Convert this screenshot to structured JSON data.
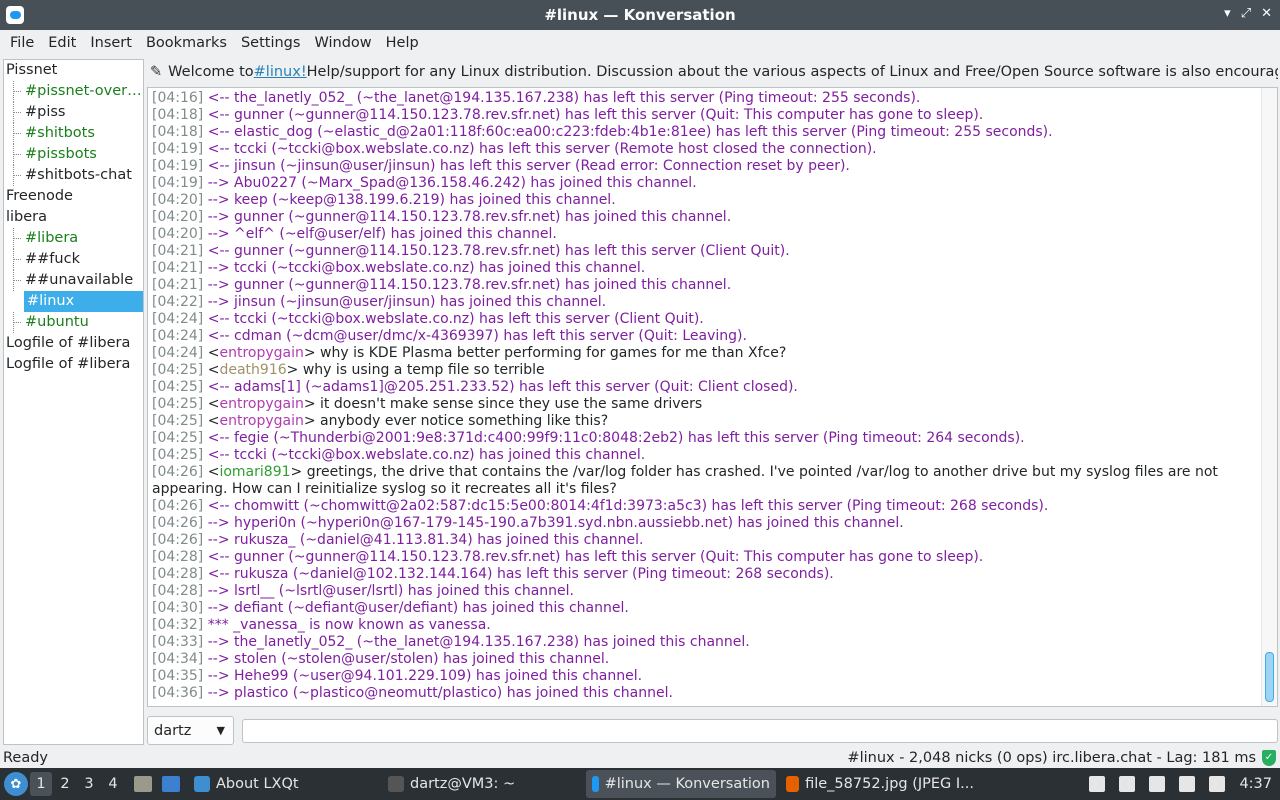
{
  "window": {
    "title": "#linux — Konversation",
    "controls": [
      "▾",
      "⤢",
      "✕"
    ]
  },
  "menu": [
    "File",
    "Edit",
    "Insert",
    "Bookmarks",
    "Settings",
    "Window",
    "Help"
  ],
  "sidebar": [
    {
      "label": "Pissnet",
      "child": false,
      "green": false
    },
    {
      "label": "#pissnet-overview",
      "child": true,
      "green": true
    },
    {
      "label": "#piss",
      "child": true,
      "green": false
    },
    {
      "label": "#shitbots",
      "child": true,
      "green": true
    },
    {
      "label": "#pissbots",
      "child": true,
      "green": true
    },
    {
      "label": "#shitbots-chat",
      "child": true,
      "green": false
    },
    {
      "label": "Freenode",
      "child": false,
      "green": false
    },
    {
      "label": "libera",
      "child": false,
      "green": false
    },
    {
      "label": "#libera",
      "child": true,
      "green": true
    },
    {
      "label": "##fuck",
      "child": true,
      "green": false
    },
    {
      "label": "##unavailable",
      "child": true,
      "green": false
    },
    {
      "label": "#linux",
      "child": true,
      "green": false,
      "selected": true
    },
    {
      "label": "#ubuntu",
      "child": true,
      "green": true
    },
    {
      "label": "Logfile of #libera",
      "child": false,
      "green": false
    },
    {
      "label": "Logfile of #libera",
      "child": false,
      "green": false
    }
  ],
  "topic": {
    "prefix": "Welcome to ",
    "link": "#linux!",
    "suffix": " Help/support for any Linux distribution. Discussion about the various aspects of Linux and Free/Open Source software is also encouraged. ..."
  },
  "messages": [
    {
      "ts": "[04:16]",
      "kind": "event",
      "text": "<-- the_lanetly_052_ (~the_lanet@194.135.167.238) has left this server (Ping timeout: 255 seconds)."
    },
    {
      "ts": "[04:18]",
      "kind": "event",
      "text": "<-- gunner (~gunner@114.150.123.78.rev.sfr.net) has left this server (Quit: This computer has gone to sleep)."
    },
    {
      "ts": "[04:18]",
      "kind": "event",
      "text": "<-- elastic_dog (~elastic_d@2a01:118f:60c:ea00:c223:fdeb:4b1e:81ee) has left this server (Ping timeout: 255 seconds)."
    },
    {
      "ts": "[04:19]",
      "kind": "event",
      "text": "<-- tccki (~tccki@box.webslate.co.nz) has left this server (Remote host closed the connection)."
    },
    {
      "ts": "[04:19]",
      "kind": "event",
      "text": "<-- jinsun (~jinsun@user/jinsun) has left this server (Read error: Connection reset by peer)."
    },
    {
      "ts": "[04:19]",
      "kind": "event",
      "text": "--> Abu0227 (~Marx_Spad@136.158.46.242) has joined this channel."
    },
    {
      "ts": "[04:20]",
      "kind": "event",
      "text": "--> keep (~keep@138.199.6.219) has joined this channel."
    },
    {
      "ts": "[04:20]",
      "kind": "event",
      "text": "--> gunner (~gunner@114.150.123.78.rev.sfr.net) has joined this channel."
    },
    {
      "ts": "[04:20]",
      "kind": "event",
      "text": "--> ^elf^ (~elf@user/elf) has joined this channel."
    },
    {
      "ts": "[04:21]",
      "kind": "event",
      "text": "<-- gunner (~gunner@114.150.123.78.rev.sfr.net) has left this server (Client Quit)."
    },
    {
      "ts": "[04:21]",
      "kind": "event",
      "text": "--> tccki (~tccki@box.webslate.co.nz) has joined this channel."
    },
    {
      "ts": "[04:21]",
      "kind": "event",
      "text": "--> gunner (~gunner@114.150.123.78.rev.sfr.net) has joined this channel."
    },
    {
      "ts": "[04:22]",
      "kind": "event",
      "text": "--> jinsun (~jinsun@user/jinsun) has joined this channel."
    },
    {
      "ts": "[04:24]",
      "kind": "event",
      "text": "<-- tccki (~tccki@box.webslate.co.nz) has left this server (Client Quit)."
    },
    {
      "ts": "[04:24]",
      "kind": "event",
      "text": "<-- cdman (~dcm@user/dmc/x-4369397) has left this server (Quit: Leaving)."
    },
    {
      "ts": "[04:24]",
      "kind": "msg",
      "nick": "entropygain",
      "nickColor": "#b03cb0",
      "text": " why is KDE Plasma better performing for games for me than Xfce?"
    },
    {
      "ts": "[04:25]",
      "kind": "msg",
      "nick": "death916",
      "nickColor": "#a0906a",
      "text": " why is using a temp file so terrible"
    },
    {
      "ts": "[04:25]",
      "kind": "event",
      "text": "<-- adams[1] (~adams1]@205.251.233.52) has left this server (Quit: Client closed)."
    },
    {
      "ts": "[04:25]",
      "kind": "msg",
      "nick": "entropygain",
      "nickColor": "#b03cb0",
      "text": " it doesn't make sense since they use the same drivers"
    },
    {
      "ts": "[04:25]",
      "kind": "msg",
      "nick": "entropygain",
      "nickColor": "#b03cb0",
      "text": " anybody ever notice something like this?"
    },
    {
      "ts": "[04:25]",
      "kind": "event",
      "text": "<-- fegie (~Thunderbi@2001:9e8:371d:c400:99f9:11c0:8048:2eb2) has left this server (Ping timeout: 264 seconds)."
    },
    {
      "ts": "[04:25]",
      "kind": "event",
      "text": "<-- tccki (~tccki@box.webslate.co.nz) has joined this channel."
    },
    {
      "ts": "[04:26]",
      "kind": "msg",
      "nick": "iomari891",
      "nickColor": "#2e9e2e",
      "text": " greetings, the drive that contains the /var/log folder has crashed. I've pointed /var/log to another drive but my syslog files are not appearing. How can I reinitialize syslog so it recreates all it's files?"
    },
    {
      "ts": "[04:26]",
      "kind": "event",
      "text": "<-- chomwitt (~chomwitt@2a02:587:dc15:5e00:8014:4f1d:3973:a5c3) has left this server (Ping timeout: 268 seconds)."
    },
    {
      "ts": "[04:26]",
      "kind": "event",
      "text": "--> hyperi0n (~hyperi0n@167-179-145-190.a7b391.syd.nbn.aussiebb.net) has joined this channel."
    },
    {
      "ts": "[04:26]",
      "kind": "event",
      "text": "--> rukusza_ (~daniel@41.113.81.34) has joined this channel."
    },
    {
      "ts": "[04:28]",
      "kind": "event",
      "text": "<-- gunner (~gunner@114.150.123.78.rev.sfr.net) has left this server (Quit: This computer has gone to sleep)."
    },
    {
      "ts": "[04:28]",
      "kind": "event",
      "text": "<-- rukusza (~daniel@102.132.144.164) has left this server (Ping timeout: 268 seconds)."
    },
    {
      "ts": "[04:28]",
      "kind": "event",
      "text": "--> lsrtl__ (~lsrtl@user/lsrtl) has joined this channel."
    },
    {
      "ts": "[04:30]",
      "kind": "event",
      "text": "--> defiant (~defiant@user/defiant) has joined this channel."
    },
    {
      "ts": "[04:32]",
      "kind": "event",
      "text": "*** _vanessa_ is now known as vanessa."
    },
    {
      "ts": "[04:33]",
      "kind": "event",
      "text": "--> the_lanetly_052_ (~the_lanet@194.135.167.238) has joined this channel."
    },
    {
      "ts": "[04:34]",
      "kind": "event",
      "text": "--> stolen (~stolen@user/stolen) has joined this channel."
    },
    {
      "ts": "[04:35]",
      "kind": "event",
      "text": "--> Hehe99 (~user@94.101.229.109) has joined this channel."
    },
    {
      "ts": "[04:36]",
      "kind": "event",
      "text": "--> plastico (~plastico@neomutt/plastico) has joined this channel."
    }
  ],
  "input": {
    "nick": "dartz",
    "value": ""
  },
  "status": {
    "left": "Ready",
    "right": "#linux - 2,048 nicks (0 ops)  irc.libera.chat - Lag: 181 ms"
  },
  "taskbar": {
    "workspaces": [
      "1",
      "2",
      "3",
      "4"
    ],
    "tasks": [
      {
        "label": "About LXQt",
        "active": false,
        "color": "#3d8fd1"
      },
      {
        "label": "dartz@VM3: ~",
        "active": false,
        "color": "#555"
      },
      {
        "label": "#linux — Konversation",
        "active": true,
        "color": "#1d99f3"
      },
      {
        "label": "file_58752.jpg (JPEG I...",
        "active": false,
        "color": "#e66000"
      }
    ],
    "clock": "4:37"
  }
}
